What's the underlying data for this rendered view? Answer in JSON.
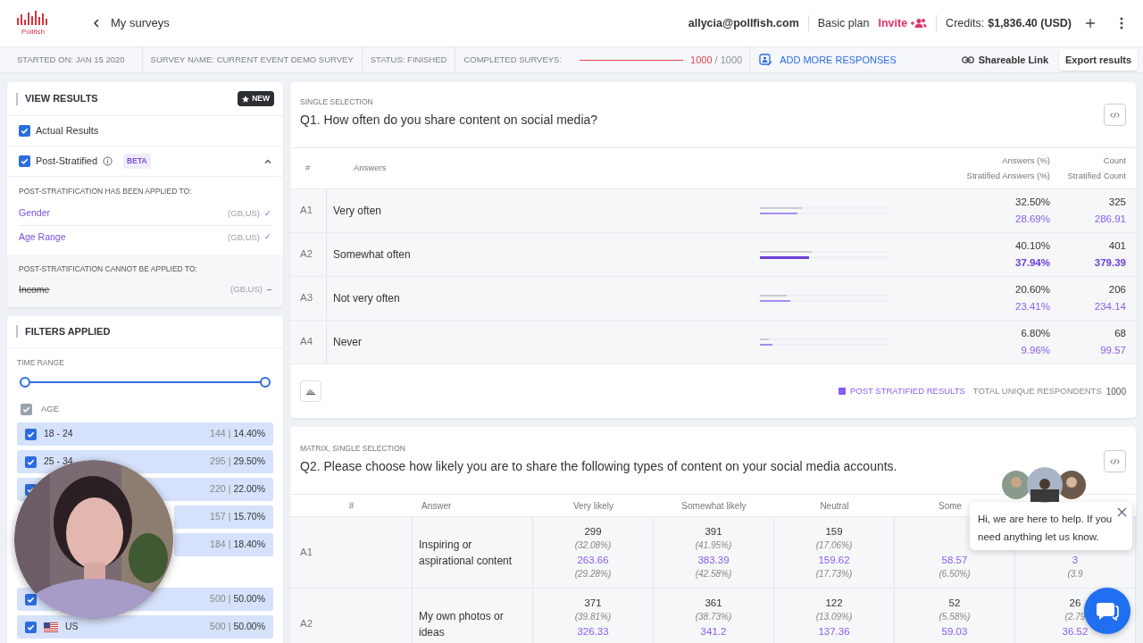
{
  "header": {
    "logo_text": "Pollfish",
    "back_label": "My surveys",
    "email": "allycia@pollfish.com",
    "plan": "Basic plan",
    "invite": "Invite",
    "credits_label": "Credits:",
    "credits_value": "$1,836.40 (USD)"
  },
  "stats": {
    "started": "STARTED ON: JAN 15 2020",
    "name": "SURVEY NAME: CURRENT EVENT DEMO SURVEY",
    "status": "STATUS: FINISHED",
    "completed_label": "COMPLETED SURVEYS:",
    "completed_bar": {
      "level": 1
    },
    "completed": "1000",
    "total": "/ 1000",
    "add_more": "ADD MORE RESPONSES",
    "share": "Shareable Link",
    "export": "Export results"
  },
  "view_results": {
    "title": "VIEW RESULTS",
    "badge": "NEW",
    "options": [
      {
        "label": "Actual Results",
        "checked": true
      },
      {
        "label": "Post-Stratified",
        "checked": true,
        "tag": "BETA",
        "expanded": true
      }
    ],
    "applied_title": "POST-STRATIFICATION HAS BEEN APPLIED TO:",
    "applied": [
      {
        "label": "Gender",
        "region": "(GB,US)",
        "mark": "✓"
      },
      {
        "label": "Age Range",
        "region": "(GB,US)",
        "mark": "✓"
      }
    ],
    "not_applied_title": "POST-STRATIFICATION CANNOT BE APPLIED TO:",
    "not_applied": [
      {
        "label": "Income",
        "region": "(GB,US)",
        "mark": "–"
      }
    ]
  },
  "filters": {
    "title": "FILTERS APPLIED",
    "time_range": "TIME RANGE",
    "range": {
      "start": {
        "level": 0
      },
      "end": {
        "level": 1
      }
    },
    "group": {
      "label": "AGE",
      "checked": true
    },
    "rows": [
      {
        "label": "18 - 24",
        "checked": true,
        "count": "144",
        "sep": "|",
        "pct": "14.40%"
      },
      {
        "label": "25 - 34",
        "checked": true,
        "count": "295",
        "sep": "|",
        "pct": "29.50%"
      },
      {
        "checked": true,
        "count": "220",
        "sep": "|",
        "pct": "22.00%"
      },
      {
        "count": "157",
        "sep": "|",
        "pct": "15.70%"
      },
      {
        "count": "184",
        "sep": "|",
        "pct": "18.40%"
      },
      {
        "gap": true,
        "checked": true,
        "count": "500",
        "sep": "|",
        "pct": "50.00%"
      },
      {
        "label": "US",
        "flag": true,
        "checked": true,
        "count": "500",
        "sep": "|",
        "pct": "50.00%"
      }
    ]
  },
  "q1": {
    "type": "SINGLE SELECTION",
    "title": "Q1. How often do you share content on social media?",
    "columns": [
      "#",
      "Answers",
      "Answers (%)",
      "Stratified Answers (%)",
      "Count",
      "Stratified Count"
    ],
    "answers": [
      {
        "id": "A1",
        "label": "Very often",
        "pct": "32.50%",
        "spct": "28.69%",
        "count": "325",
        "scount": "286.91",
        "highlighted": false,
        "bars": [
          {
            "kind": "actual",
            "level": 0.325
          },
          {
            "kind": "stratified",
            "level": 0.2869
          }
        ]
      },
      {
        "id": "A2",
        "label": "Somewhat often",
        "pct": "40.10%",
        "spct": "37.94%",
        "count": "401",
        "scount": "379.39",
        "highlighted": true,
        "bars": [
          {
            "kind": "actual",
            "level": 0.401
          },
          {
            "kind": "stratified",
            "level": 0.3794
          }
        ]
      },
      {
        "id": "A3",
        "label": "Not very often",
        "pct": "20.60%",
        "spct": "23.41%",
        "count": "206",
        "scount": "234.14",
        "highlighted": false,
        "bars": [
          {
            "kind": "actual",
            "level": 0.206
          },
          {
            "kind": "stratified",
            "level": 0.2341
          }
        ]
      },
      {
        "id": "A4",
        "label": "Never",
        "pct": "6.80%",
        "spct": "9.96%",
        "count": "68",
        "scount": "99.57",
        "highlighted": false,
        "bars": [
          {
            "kind": "actual",
            "level": 0.068
          },
          {
            "kind": "stratified",
            "level": 0.0996
          }
        ]
      }
    ],
    "legend": "POST STRATIFIED RESULTS",
    "respondents_label": "TOTAL UNIQUE RESPONDENTS",
    "respondents": "1000"
  },
  "q2": {
    "type": "MATRIX, SINGLE SELECTION",
    "title": "Q2. Please choose how likely you are to share the following types of content on your social media accounts.",
    "columns": [
      "#",
      "Answer",
      "Very likely",
      "Somewhat likely",
      "Neutral",
      "Some"
    ],
    "rows": [
      {
        "cells": [
          {
            "text": "A1"
          },
          {
            "text": "Inspiring or aspirational content"
          },
          {
            "count": "299",
            "pct": "(32.08%)",
            "scount": "263.66",
            "spct": "(29.28%)"
          },
          {
            "count": "391",
            "pct": "(41.95%)",
            "scount": "383.39",
            "spct": "(42.58%)"
          },
          {
            "count": "159",
            "pct": "(17.06%)",
            "scount": "159.62",
            "spct": "(17.73%)"
          },
          {
            "scount": "58.57",
            "spct": "(6.50%)"
          },
          {
            "scount": "3",
            "spct": "(3.9"
          }
        ]
      },
      {
        "cells": [
          {
            "text": "A2"
          },
          {
            "text": "My own photos or ideas"
          },
          {
            "count": "371",
            "pct": "(39.81%)",
            "scount": "326.33"
          },
          {
            "count": "361",
            "pct": "(38.73%)",
            "scount": "341.2"
          },
          {
            "count": "122",
            "pct": "(13.09%)",
            "scount": "137.36"
          },
          {
            "count": "52",
            "pct": "(5.58%)",
            "scount": "59.03"
          },
          {
            "count": "26",
            "pct": "(2.79",
            "scount": "36.52"
          }
        ]
      }
    ]
  },
  "chat": {
    "message": "Hi, we are here to help. If you need anything let us know."
  }
}
